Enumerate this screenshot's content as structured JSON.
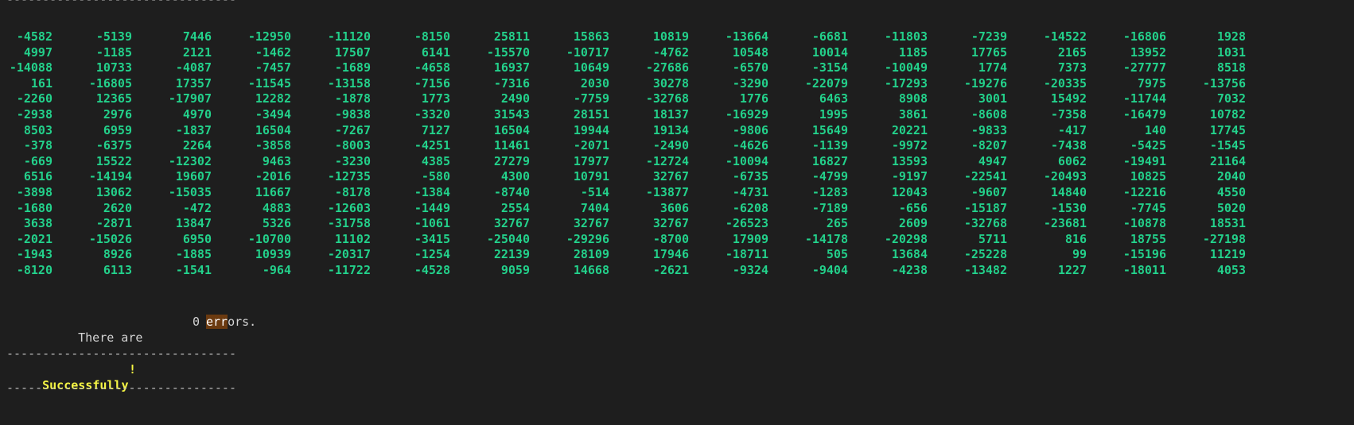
{
  "rules": {
    "top": "--------------------------------",
    "mid": "--------------------------------",
    "bottom": "--------------------------------"
  },
  "matrix": [
    [
      "-4582",
      "-5139",
      "7446",
      "-12950",
      "-11120",
      "-8150",
      "25811",
      "15863",
      "10819",
      "-13664",
      "-6681",
      "-11803",
      "-7239",
      "-14522",
      "-16806",
      "1928"
    ],
    [
      "4997",
      "-1185",
      "2121",
      "-1462",
      "17507",
      "6141",
      "-15570",
      "-10717",
      "-4762",
      "10548",
      "10014",
      "1185",
      "17765",
      "2165",
      "13952",
      "1031"
    ],
    [
      "-14088",
      "10733",
      "-4087",
      "-7457",
      "-1689",
      "-4658",
      "16937",
      "10649",
      "-27686",
      "-6570",
      "-3154",
      "-10049",
      "1774",
      "7373",
      "-27777",
      "8518"
    ],
    [
      "161",
      "-16805",
      "17357",
      "-11545",
      "-13158",
      "-7156",
      "-7316",
      "2030",
      "30278",
      "-3290",
      "-22079",
      "-17293",
      "-19276",
      "-20335",
      "7975",
      "-13756"
    ],
    [
      "-2260",
      "12365",
      "-17907",
      "12282",
      "-1878",
      "1773",
      "2490",
      "-7759",
      "-32768",
      "1776",
      "6463",
      "8908",
      "3001",
      "15492",
      "-11744",
      "7032"
    ],
    [
      "-2938",
      "2976",
      "4970",
      "-3494",
      "-9838",
      "-3320",
      "31543",
      "28151",
      "18137",
      "-16929",
      "1995",
      "3861",
      "-8608",
      "-7358",
      "-16479",
      "10782"
    ],
    [
      "8503",
      "6959",
      "-1837",
      "16504",
      "-7267",
      "7127",
      "16504",
      "19944",
      "19134",
      "-9806",
      "15649",
      "20221",
      "-9833",
      "-417",
      "140",
      "17745"
    ],
    [
      "-378",
      "-6375",
      "2264",
      "-3858",
      "-8003",
      "-4251",
      "11461",
      "-2071",
      "-2490",
      "-4626",
      "-1139",
      "-9972",
      "-8207",
      "-7438",
      "-5425",
      "-1545"
    ],
    [
      "-669",
      "15522",
      "-12302",
      "9463",
      "-3230",
      "4385",
      "27279",
      "17977",
      "-12724",
      "-10094",
      "16827",
      "13593",
      "4947",
      "6062",
      "-19491",
      "21164"
    ],
    [
      "6516",
      "-14194",
      "19607",
      "-2016",
      "-12735",
      "-580",
      "4300",
      "10791",
      "32767",
      "-6735",
      "-4799",
      "-9197",
      "-22541",
      "-20493",
      "10825",
      "2040"
    ],
    [
      "-3898",
      "13062",
      "-15035",
      "11667",
      "-8178",
      "-1384",
      "-8740",
      "-514",
      "-13877",
      "-4731",
      "-1283",
      "12043",
      "-9607",
      "14840",
      "-12216",
      "4550"
    ],
    [
      "-1680",
      "2620",
      "-472",
      "4883",
      "-12603",
      "-1449",
      "2554",
      "7404",
      "3606",
      "-6208",
      "-7189",
      "-656",
      "-15187",
      "-1530",
      "-7745",
      "5020"
    ],
    [
      "3638",
      "-2871",
      "13847",
      "5326",
      "-31758",
      "-1061",
      "32767",
      "32767",
      "32767",
      "-26523",
      "265",
      "2609",
      "-32768",
      "-23681",
      "-10878",
      "18531"
    ],
    [
      "-2021",
      "-15026",
      "6950",
      "-10700",
      "11102",
      "-3415",
      "-25040",
      "-29296",
      "-8700",
      "17909",
      "-14178",
      "-20298",
      "5711",
      "816",
      "18755",
      "-27198"
    ],
    [
      "-1943",
      "8926",
      "-1885",
      "10939",
      "-20317",
      "-1254",
      "22139",
      "28109",
      "17946",
      "-18711",
      "505",
      "13684",
      "-25228",
      "99",
      "-15196",
      "11219"
    ],
    [
      "-8120",
      "6113",
      "-1541",
      "-964",
      "-11722",
      "-4528",
      "9059",
      "14668",
      "-2621",
      "-9324",
      "-9404",
      "-4238",
      "-13482",
      "1227",
      "-18011",
      "4053"
    ]
  ],
  "summary": {
    "prefix": "There are",
    "count": "0",
    "error_word_highlight": "err",
    "error_word_rest": "ors."
  },
  "status": {
    "message": "Successfully",
    "bang": "!"
  },
  "colors": {
    "background": "#1e1e1e",
    "matrix_text": "#23d18b",
    "success_text": "#f5f543",
    "highlight_bg": "#6b3a10"
  }
}
